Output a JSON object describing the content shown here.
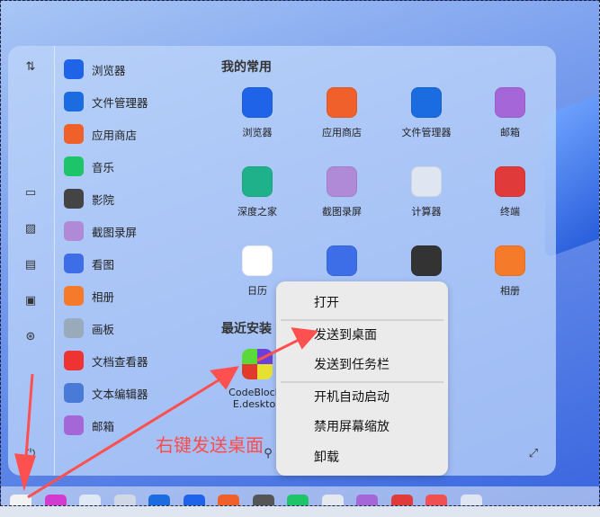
{
  "left_icons": [
    "sort-icon",
    "desktop-icon",
    "image-icon",
    "document-icon",
    "terminal-icon",
    "settings-icon"
  ],
  "app_list": [
    {
      "label": "浏览器",
      "color": "#1e63e8"
    },
    {
      "label": "文件管理器",
      "color": "#1a6ce0"
    },
    {
      "label": "应用商店",
      "color": "#f0602a"
    },
    {
      "label": "音乐",
      "color": "#1ec46a"
    },
    {
      "label": "影院",
      "color": "#444"
    },
    {
      "label": "截图录屏",
      "color": "#b08ad6"
    },
    {
      "label": "看图",
      "color": "#3d6ee8"
    },
    {
      "label": "相册",
      "color": "#f57a2a"
    },
    {
      "label": "画板",
      "color": "#9ab"
    },
    {
      "label": "文档查看器",
      "color": "#e33"
    },
    {
      "label": "文本编辑器",
      "color": "#4a7ad8"
    },
    {
      "label": "邮箱",
      "color": "#a566d8"
    }
  ],
  "favorites_title": "我的常用",
  "favorites": [
    {
      "label": "浏览器",
      "color": "#1e63e8"
    },
    {
      "label": "应用商店",
      "color": "#f0602a"
    },
    {
      "label": "文件管理器",
      "color": "#1a6ce0"
    },
    {
      "label": "邮箱",
      "color": "#a566d8"
    },
    {
      "label": "深度之家",
      "color": "#1fb28a"
    },
    {
      "label": "截图录屏",
      "color": "#b08ad6"
    },
    {
      "label": "计算器",
      "color": "#dfe6f2"
    },
    {
      "label": "终端",
      "color": "#e03a3a"
    },
    {
      "label": "日历",
      "color": "#ffffff"
    },
    {
      "label": "",
      "color": "#3d6ee8"
    },
    {
      "label": "",
      "color": "#333"
    },
    {
      "label": "相册",
      "color": "#f57a2a"
    }
  ],
  "recent_title": "最近安装",
  "recent_app": {
    "label_line1": "CodeBlocks",
    "label_line2": "E.desktop"
  },
  "context_menu": [
    "打开",
    "发送到桌面",
    "发送到任务栏",
    "开机自动启动",
    "禁用屏幕缩放",
    "卸载"
  ],
  "annotation": "右键发送桌面",
  "dock_colors": [
    "#f2f2f2",
    "#d23ad0",
    "#dfe8f5",
    "#cfd8e4",
    "#1a6ce0",
    "#1e63e8",
    "#f0602a",
    "#555",
    "#1ec46a",
    "#e5e8ee",
    "#a566d8",
    "#e03a3a",
    "#f05050",
    "#dfe6f2"
  ]
}
